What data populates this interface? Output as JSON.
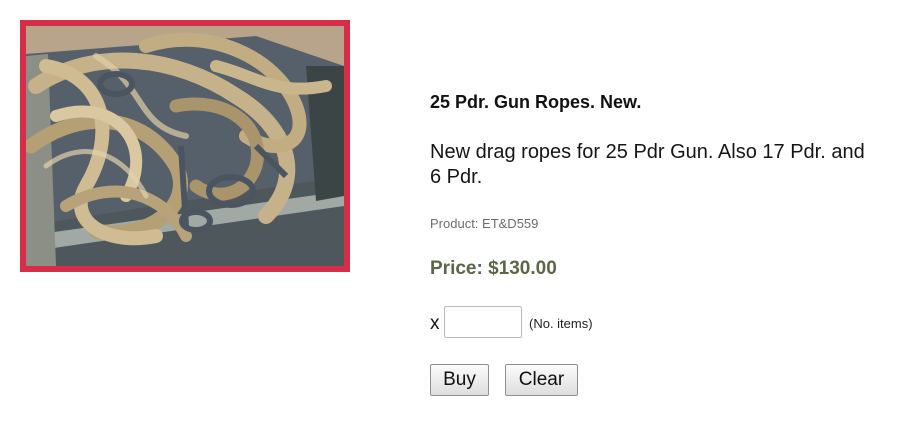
{
  "product": {
    "image_alt": "Coiled hemp drag ropes with metal fittings in a wooden crate",
    "title": "25 Pdr. Gun Ropes. New.",
    "description": "New drag ropes for 25 Pdr Gun. Also 17 Pdr. and 6 Pdr.",
    "code": "Product: ET&D559",
    "price": "Price: $130.00"
  },
  "order": {
    "qty_prefix": "x",
    "qty_value": "",
    "qty_hint": "(No. items)",
    "buy_label": "Buy",
    "clear_label": "Clear"
  },
  "colors": {
    "frame": "#d62e49",
    "price": "#5a6645"
  }
}
